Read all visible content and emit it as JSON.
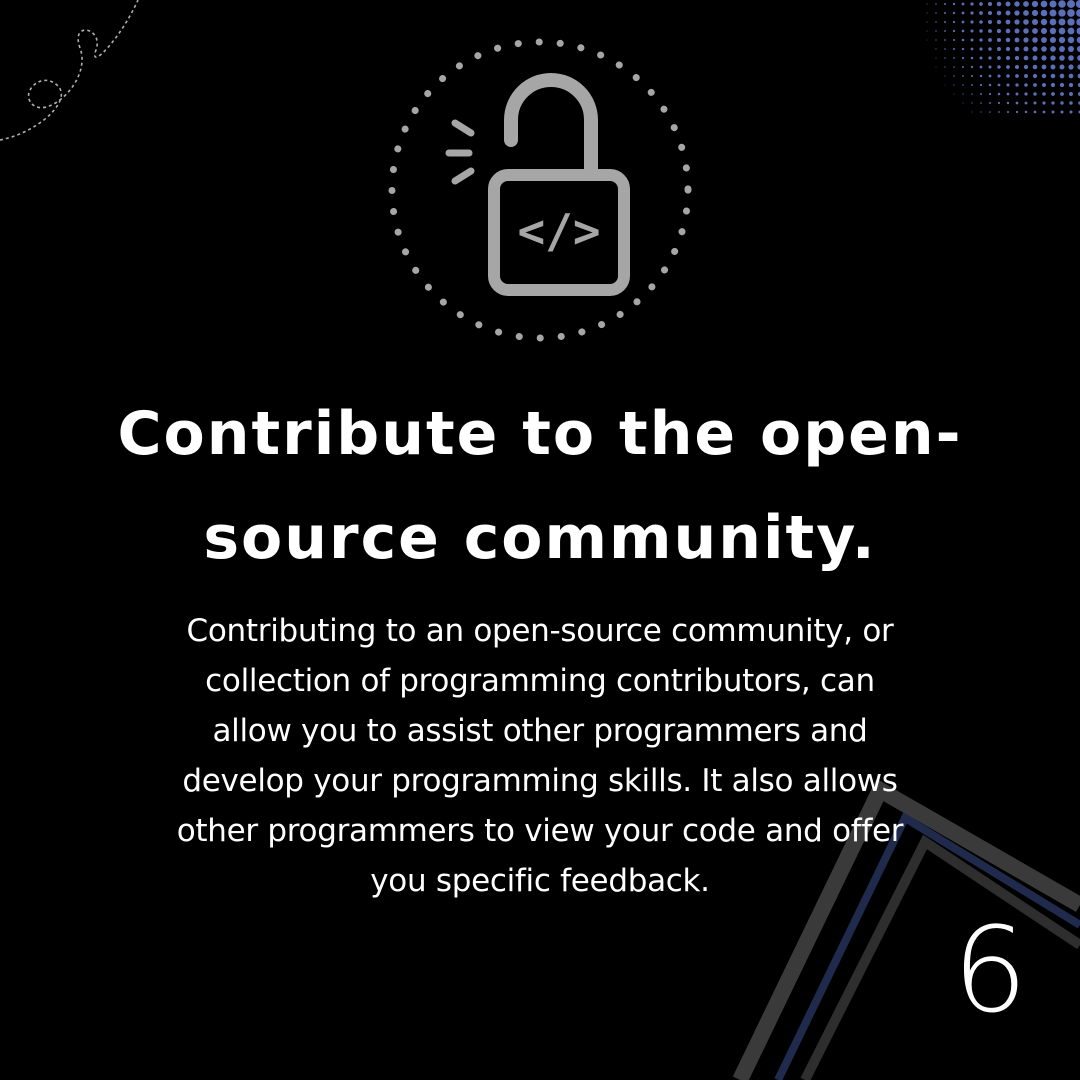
{
  "icon": {
    "name": "unlocked-padlock-code-icon",
    "code_glyph": "</>",
    "color": "#a6a6a6"
  },
  "headline": {
    "line1": "Contribute to the open-",
    "line2": "source community."
  },
  "body": {
    "lines": [
      "Contributing to an open-source community, or",
      "collection of programming contributors, can",
      "allow you to assist other programmers and",
      "develop your programming skills. It also allows",
      "other programmers to view your code and offer",
      "you specific feedback."
    ]
  },
  "page_number": "6",
  "colors": {
    "background": "#000000",
    "text": "#ffffff",
    "accent_blue": "#5b6fb8",
    "stripe_gray": "#3a3a3a",
    "stripe_navy": "#1f2a4d"
  }
}
